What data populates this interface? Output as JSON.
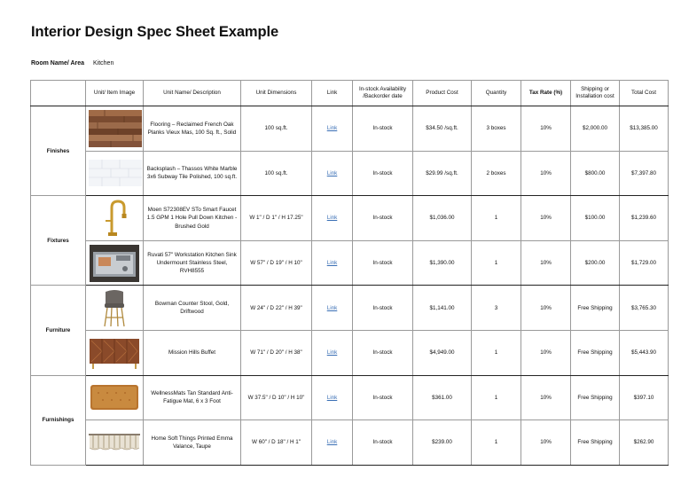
{
  "title": "Interior Design Spec Sheet Example",
  "room": {
    "label": "Room Name/ Area",
    "value": "Kitchen"
  },
  "headers": {
    "image": "Unit/ Item Image",
    "name": "Unit Name/ Description",
    "dims": "Unit Dimensions",
    "link": "Link",
    "stock": "In-stock Availability /Backorder date",
    "cost": "Product Cost",
    "qty": "Quantity",
    "tax": "Tax Rate (%)",
    "ship": "Shipping or Installation cost",
    "total": "Total Cost"
  },
  "categories": [
    "Finishes",
    "Fixtures",
    "Furniture",
    "Furnishings"
  ],
  "rows": [
    {
      "icon": "wood-flooring-image",
      "name": "Flooring – Reclaimed French Oak Planks Vieux Mas, 100 Sq. ft., Solid",
      "dims": "100 sq.ft.",
      "link": "Link",
      "stock": "In-stock",
      "cost": "$34.50 /sq.ft.",
      "qty": "3 boxes",
      "tax": "10%",
      "ship": "$2,000.00",
      "total": "$13,385.00"
    },
    {
      "icon": "marble-tile-image",
      "name": "Backsplash – Thassos White Marble 3x6 Subway Tile Polished, 100 sq.ft.",
      "dims": "100 sq.ft.",
      "link": "Link",
      "stock": "In-stock",
      "cost": "$29.99 /sq.ft.",
      "qty": "2 boxes",
      "tax": "10%",
      "ship": "$800.00",
      "total": "$7,397.80"
    },
    {
      "icon": "faucet-image",
      "name": "Moen S72308EV STo Smart Faucet 1.5 GPM 1 Hole Pull Down Kitchen - Brushed Gold",
      "dims": "W 1\" / D 1\" / H 17.25\"",
      "link": "Link",
      "stock": "In-stock",
      "cost": "$1,036.00",
      "qty": "1",
      "tax": "10%",
      "ship": "$100.00",
      "total": "$1,239.60"
    },
    {
      "icon": "kitchen-sink-image",
      "name": "Ruvati 57\" Workstation Kitchen Sink Undermount Stainless Steel, RVH8555",
      "dims": "W 57\" / D 19\" / H 10\"",
      "link": "Link",
      "stock": "In-stock",
      "cost": "$1,390.00",
      "qty": "1",
      "tax": "10%",
      "ship": "$200.00",
      "total": "$1,729.00"
    },
    {
      "icon": "counter-stool-image",
      "name": "Bowman Counter Stool, Gold, Driftwood",
      "dims": "W 24\" / D 22\" / H 39\"",
      "link": "Link",
      "stock": "In-stock",
      "cost": "$1,141.00",
      "qty": "3",
      "tax": "10%",
      "ship": "Free Shipping",
      "total": "$3,765.30"
    },
    {
      "icon": "buffet-image",
      "name": "Mission Hills Buffet",
      "dims": "W 71\" / D 20\" / H 38\"",
      "link": "Link",
      "stock": "In-stock",
      "cost": "$4,949.00",
      "qty": "1",
      "tax": "10%",
      "ship": "Free Shipping",
      "total": "$5,443.90"
    },
    {
      "icon": "floor-mat-image",
      "name": "WellnessMats Tan Standard Anti-Fatigue Mat, 6 x 3 Foot",
      "dims": "W 37.5\" / D 10\" / H 10\"",
      "link": "Link",
      "stock": "In-stock",
      "cost": "$361.00",
      "qty": "1",
      "tax": "10%",
      "ship": "Free Shipping",
      "total": "$397.10"
    },
    {
      "icon": "valance-image",
      "name": "Home Soft Things Printed Emma Valance, Taupe",
      "dims": "W 60\" / D 18\" / H 1\"",
      "link": "Link",
      "stock": "In-stock",
      "cost": "$239.00",
      "qty": "1",
      "tax": "10%",
      "ship": "Free Shipping",
      "total": "$262.90"
    }
  ]
}
